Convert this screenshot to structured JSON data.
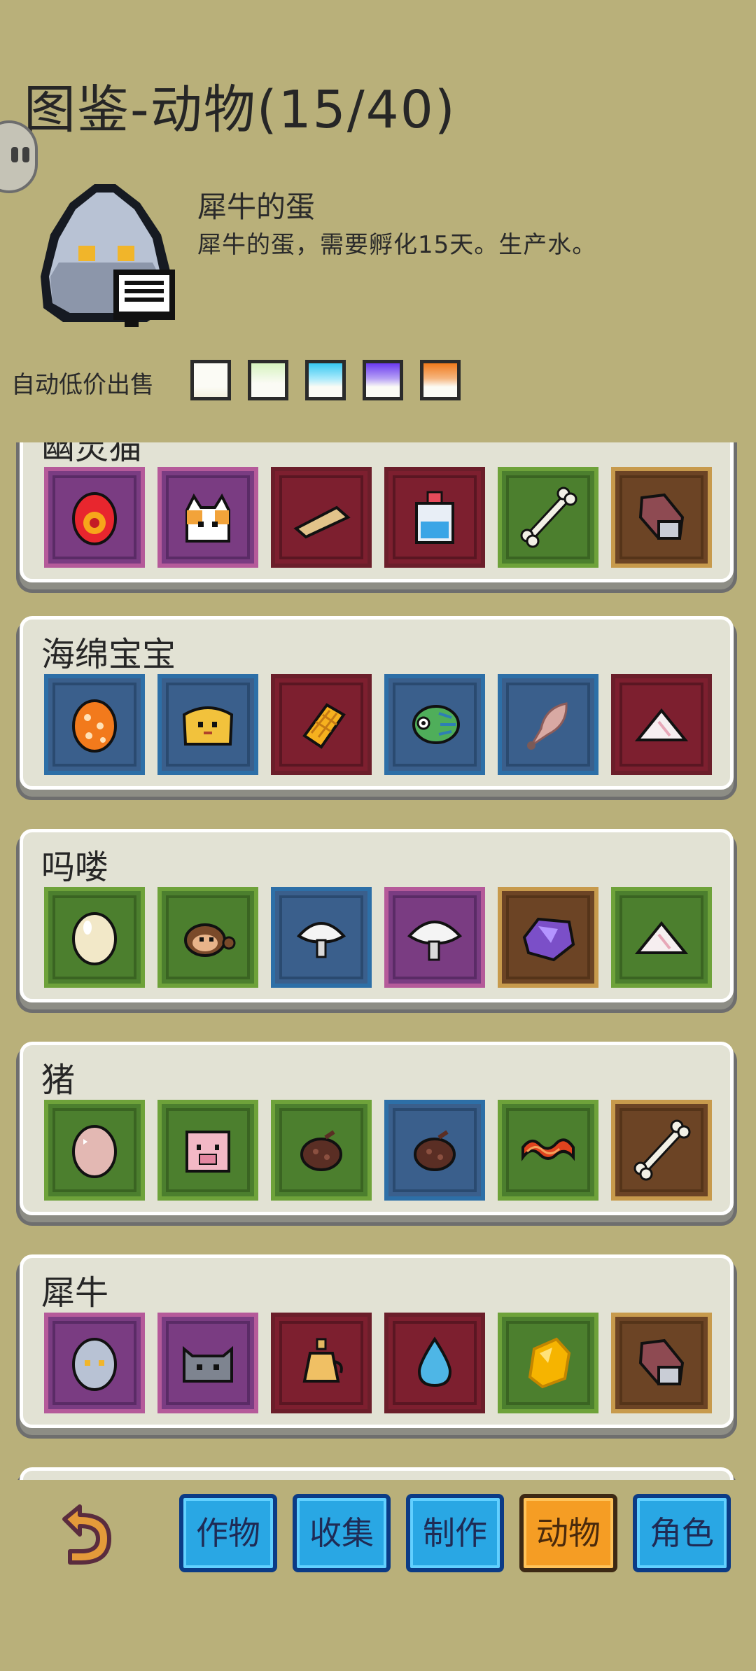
{
  "header": {
    "title": "图鉴-动物(15/40)"
  },
  "selected_item": {
    "name": "犀牛的蛋",
    "description": "犀牛的蛋，需要孵化15天。生产水。",
    "icon": "rhino-egg-icon"
  },
  "auto_sell": {
    "label": "自动低价出售",
    "rarity_colors": [
      "#f4f1df",
      "#a6e37a",
      "#37c7f1",
      "#6b3aef",
      "#f07a1c"
    ]
  },
  "categories": [
    {
      "title": "幽灵猫",
      "items": [
        {
          "icon": "fire-egg-icon",
          "frame": "purple"
        },
        {
          "icon": "ghost-cat-icon",
          "frame": "purple"
        },
        {
          "icon": "bread-loaf-icon",
          "frame": "red"
        },
        {
          "icon": "potion-bottle-icon",
          "frame": "red"
        },
        {
          "icon": "bone-icon",
          "frame": "green"
        },
        {
          "icon": "meat-cut-icon",
          "frame": "brown"
        }
      ]
    },
    {
      "title": "海绵宝宝",
      "items": [
        {
          "icon": "spotted-egg-icon",
          "frame": "blue"
        },
        {
          "icon": "sponge-creature-icon",
          "frame": "blue"
        },
        {
          "icon": "honeycomb-icon",
          "frame": "red"
        },
        {
          "icon": "fish-icon",
          "frame": "blue"
        },
        {
          "icon": "feather-icon",
          "frame": "blue"
        },
        {
          "icon": "salt-pile-icon",
          "frame": "red"
        }
      ]
    },
    {
      "title": "吗喽",
      "items": [
        {
          "icon": "cream-egg-icon",
          "frame": "green"
        },
        {
          "icon": "monkey-icon",
          "frame": "green"
        },
        {
          "icon": "mushroom-icon",
          "frame": "blue"
        },
        {
          "icon": "mushroom-icon",
          "frame": "purple"
        },
        {
          "icon": "amethyst-ore-icon",
          "frame": "brown"
        },
        {
          "icon": "salt-pile-icon",
          "frame": "green"
        }
      ]
    },
    {
      "title": "猪",
      "items": [
        {
          "icon": "pink-egg-icon",
          "frame": "green"
        },
        {
          "icon": "pig-icon",
          "frame": "green"
        },
        {
          "icon": "truffle-icon",
          "frame": "green"
        },
        {
          "icon": "truffle-icon",
          "frame": "blue"
        },
        {
          "icon": "bacon-icon",
          "frame": "green"
        },
        {
          "icon": "bone-icon",
          "frame": "brown"
        }
      ]
    },
    {
      "title": "犀牛",
      "items": [
        {
          "icon": "rhino-egg-icon",
          "frame": "purple"
        },
        {
          "icon": "rhino-icon",
          "frame": "purple"
        },
        {
          "icon": "oil-flask-icon",
          "frame": "red"
        },
        {
          "icon": "water-drop-icon",
          "frame": "red"
        },
        {
          "icon": "gold-nugget-icon",
          "frame": "green"
        },
        {
          "icon": "meat-cut-icon",
          "frame": "brown"
        }
      ]
    }
  ],
  "bottom_tabs": [
    {
      "label": "作物",
      "active": false
    },
    {
      "label": "收集",
      "active": false
    },
    {
      "label": "制作",
      "active": false
    },
    {
      "label": "动物",
      "active": true
    },
    {
      "label": "角色",
      "active": false
    }
  ]
}
